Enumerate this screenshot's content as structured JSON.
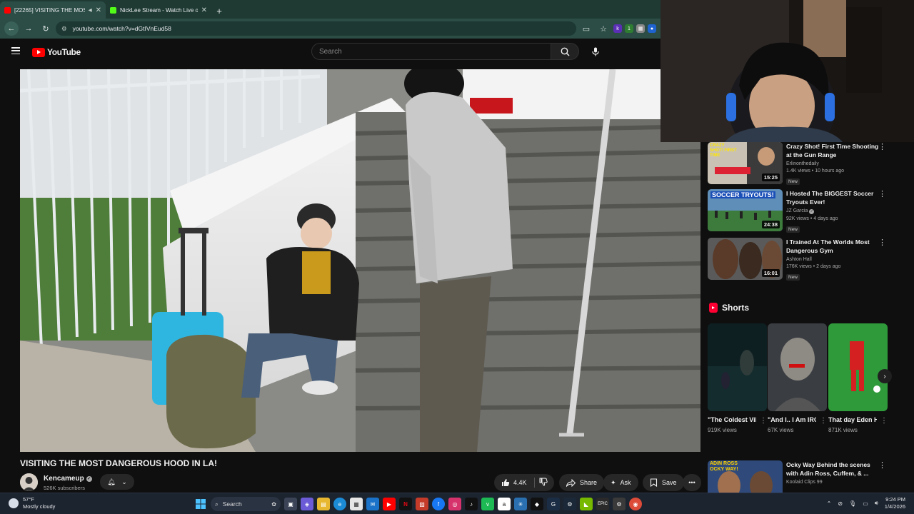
{
  "browser": {
    "tabs": [
      {
        "title": "[22265] VISITING THE MOS",
        "active": true,
        "favicon_color": "#ff0000"
      },
      {
        "title": "NickLee Stream - Watch Live o",
        "active": false,
        "favicon_color": "#53fc18"
      }
    ],
    "new_tab_icon": "plus-icon",
    "url": "youtube.com/watch?v=dGtIVnEud58"
  },
  "youtube": {
    "logo_text": "YouTube",
    "search_placeholder": "Search"
  },
  "video": {
    "title": "VISITING THE MOST DANGEROUS HOOD IN LA!",
    "channel": "Kencameup",
    "subscribers": "526K subscribers",
    "likes": "4.4K",
    "share_label": "Share",
    "ask_label": "Ask",
    "save_label": "Save"
  },
  "recommendations": [
    {
      "title": "Crazy Shot! First Time Shooting at the Gun Range",
      "channel": "Erlinonthedaily",
      "meta": "1.4K views • 10 hours ago",
      "badge": "New",
      "duration": "15:25",
      "thumb_text": "CRAZY SHOT! FIRST TIME",
      "verified": false
    },
    {
      "title": "I Hosted The BIGGEST Soccer Tryouts Ever!",
      "channel": "JZ Garcia",
      "meta": "92K views • 4 days ago",
      "badge": "New",
      "duration": "24:38",
      "thumb_text": "SOCCER TRYOUTS!",
      "verified": true
    },
    {
      "title": "I Trained At The Worlds Most Dangerous Gym",
      "channel": "Ashton Hall",
      "meta": "176K views • 2 days ago",
      "badge": "New",
      "duration": "16:01",
      "thumb_text": "",
      "verified": false
    },
    {
      "title": "Ocky Way Behind the scenes with Adin Ross, Cuffem, & ...",
      "channel": "Koolaid Clips 99",
      "meta": "",
      "badge": "",
      "duration": "",
      "thumb_text": "ADIN ROSS OCKY WAY!",
      "verified": false
    }
  ],
  "shorts": {
    "heading": "Shorts",
    "items": [
      {
        "title": "\"The Coldest Villian\"- Tai ...",
        "views": "919K views"
      },
      {
        "title": "\"And I.. I Am IRON MAN\"...",
        "views": "67K views"
      },
      {
        "title": "That day Eden Hazar...",
        "views": "871K views"
      }
    ]
  },
  "taskbar": {
    "temperature": "57°F",
    "weather": "Mostly cloudy",
    "search_label": "Search",
    "time": "9:24 PM",
    "date": "1/4/2026"
  }
}
